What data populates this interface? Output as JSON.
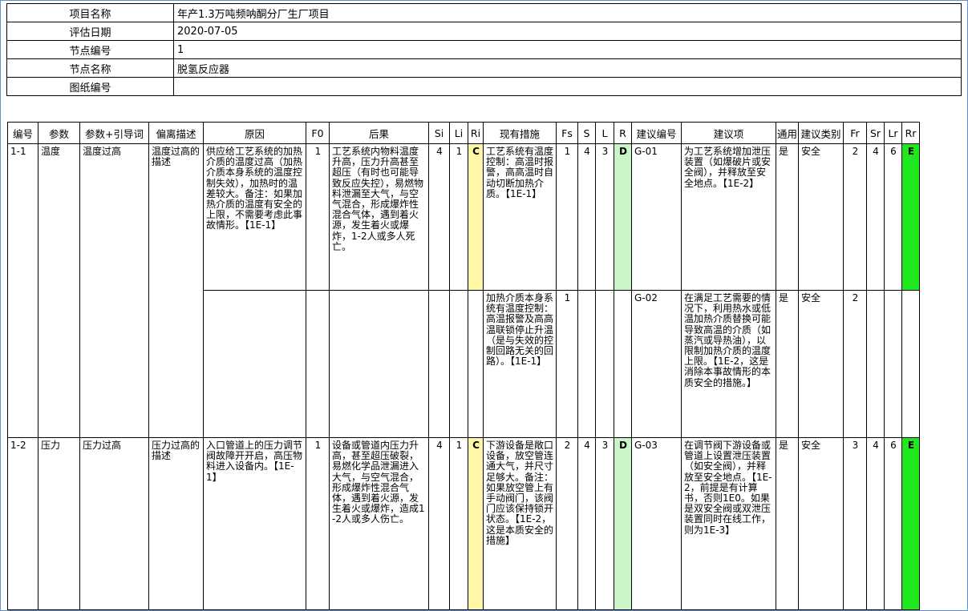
{
  "info": [
    {
      "label": "项目名称",
      "value": "年产1.3万吨频呐酮分厂生厂项目"
    },
    {
      "label": "评估日期",
      "value": "2020-07-05"
    },
    {
      "label": "节点编号",
      "value": "1"
    },
    {
      "label": "节点名称",
      "value": "脱氢反应器"
    },
    {
      "label": "图纸编号",
      "value": ""
    }
  ],
  "headers": [
    "编号",
    "参数",
    "参数+引导词",
    "偏离描述",
    "原因",
    "F0",
    "后果",
    "Si",
    "Li",
    "Ri",
    "现有措施",
    "Fs",
    "S",
    "L",
    "R",
    "建议编号",
    "建议项",
    "通用",
    "建议类别",
    "Fr",
    "Sr",
    "Lr",
    "Rr"
  ],
  "rows": [
    {
      "id": "1-1",
      "param": "温度",
      "guide": "温度过高",
      "deviation": "温度过高的描述",
      "cause": "供应给工艺系统的加热介质的温度过高（加热介质本身系统的温度控制失效），加热时的温差较大。备注：如果加热介质的温度有安全的上限，不需要考虑此事故情形。【1E-1】",
      "f0": "1",
      "consequence": "工艺系统内物料温度升高，压力升高甚至超压（有时也可能导致反应失控），易燃物料泄漏至大气，与空气混合，形成爆炸性混合气体，遇到着火源，发生着火或爆炸，1-2人或多人死亡。",
      "si": "4",
      "li": "1",
      "ri": "C",
      "measures": [
        {
          "text": "工艺系统有温度控制：高温时报警，高高温时自动切断加热介质。【1E-1】",
          "fs": "1"
        },
        {
          "text": "加热介质本身系统有温度控制：高温报警及高高温联锁停止升温（是与失效的控制回路无关的回路）。【1E-1】",
          "fs": "1"
        }
      ],
      "s": "4",
      "l": "3",
      "r": "D",
      "recs": [
        {
          "no": "G-01",
          "text": "为工艺系统增加泄压装置（如爆破片或安全阀），并释放至安全地点。【1E-2】",
          "common": "是",
          "category": "安全",
          "fr": "2"
        },
        {
          "no": "G-02",
          "text": "在满足工艺需要的情况下，利用热水或低温加热介质替换可能导致高温的介质（如蒸汽或导热油），以限制加热介质的温度上限。【1E-2，这是消除本事故情形的本质安全的措施。】",
          "common": "是",
          "category": "安全",
          "fr": "2"
        }
      ],
      "sr": "4",
      "lr": "6",
      "rr": "E"
    },
    {
      "id": "1-2",
      "param": "压力",
      "guide": "压力过高",
      "deviation": "压力过高的描述",
      "cause": "入口管道上的压力调节阀故障开开启，高压物料进入设备内。【1E-1】",
      "f0": "1",
      "consequence": "设备或管道内压力升高，甚至超压破裂，易燃化学品泄漏进入大气，与空气混合，形成爆炸性混合气体，遇到着火源，发生着火或爆炸，造成1-2人或多人伤亡。",
      "si": "4",
      "li": "1",
      "ri": "C",
      "measure": "下游设备是敞口设备，放空管连通大气，并尺寸足够大。备注：如果放空管上有手动阀门，该阀门应该保持锁开状态。【1E-2，这是本质安全的措施】",
      "fs": "2",
      "s": "4",
      "l": "3",
      "r": "D",
      "rec": {
        "no": "G-03",
        "text": "在调节阀下游设备或管道上设置泄压装置（如安全阀），并释放至安全地点。【1E-2，前提是有计算书，否则1E0。如果是双安全阀或双泄压装置同时在线工作，则为1E-3】",
        "common": "是",
        "category": "安全",
        "fr": "3"
      },
      "sr": "4",
      "lr": "6",
      "rr": "E"
    }
  ],
  "colors": {
    "ri": "#fff7a8",
    "r": "#c9f5c9",
    "rr": "#1fe81f",
    "frame": "#6b8fc4"
  }
}
